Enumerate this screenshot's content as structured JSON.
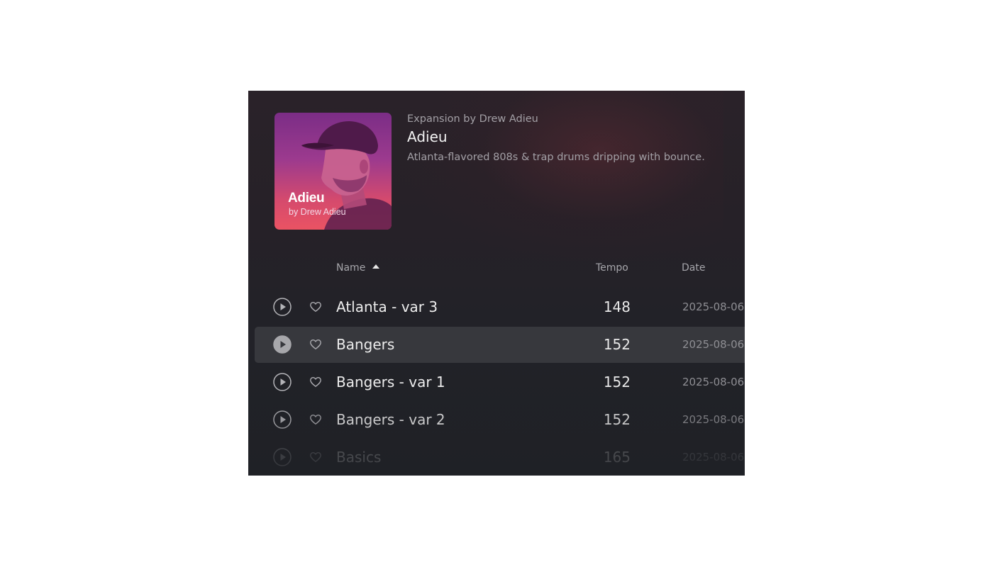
{
  "header": {
    "cover": {
      "title": "Adieu",
      "subtitle": "by Drew Adieu",
      "gradient_top": "#7b2d86",
      "gradient_bottom": "#ea5363"
    },
    "byline": "Expansion by Drew Adieu",
    "title": "Adieu",
    "description": "Atlanta-flavored 808s & trap drums dripping with bounce."
  },
  "columns": {
    "name": "Name",
    "tempo": "Tempo",
    "date": "Date",
    "sort": "name-ascending"
  },
  "rows": [
    {
      "name": "Atlanta - var 3",
      "tempo": "148",
      "date": "2025-08-06",
      "selected": false
    },
    {
      "name": "Bangers",
      "tempo": "152",
      "date": "2025-08-06",
      "selected": true
    },
    {
      "name": "Bangers - var 1",
      "tempo": "152",
      "date": "2025-08-06",
      "selected": false
    },
    {
      "name": "Bangers - var 2",
      "tempo": "152",
      "date": "2025-08-06",
      "selected": false
    },
    {
      "name": "Basics",
      "tempo": "165",
      "date": "2025-08-06",
      "selected": false
    }
  ],
  "icons": {
    "play": "play-icon",
    "favorite": "heart-icon",
    "sort": "sort-ascending-icon"
  },
  "colors": {
    "panel_background": "#222228",
    "selected_row": "#37383d",
    "text_primary": "#ededed",
    "text_secondary": "#a3a0a6"
  }
}
